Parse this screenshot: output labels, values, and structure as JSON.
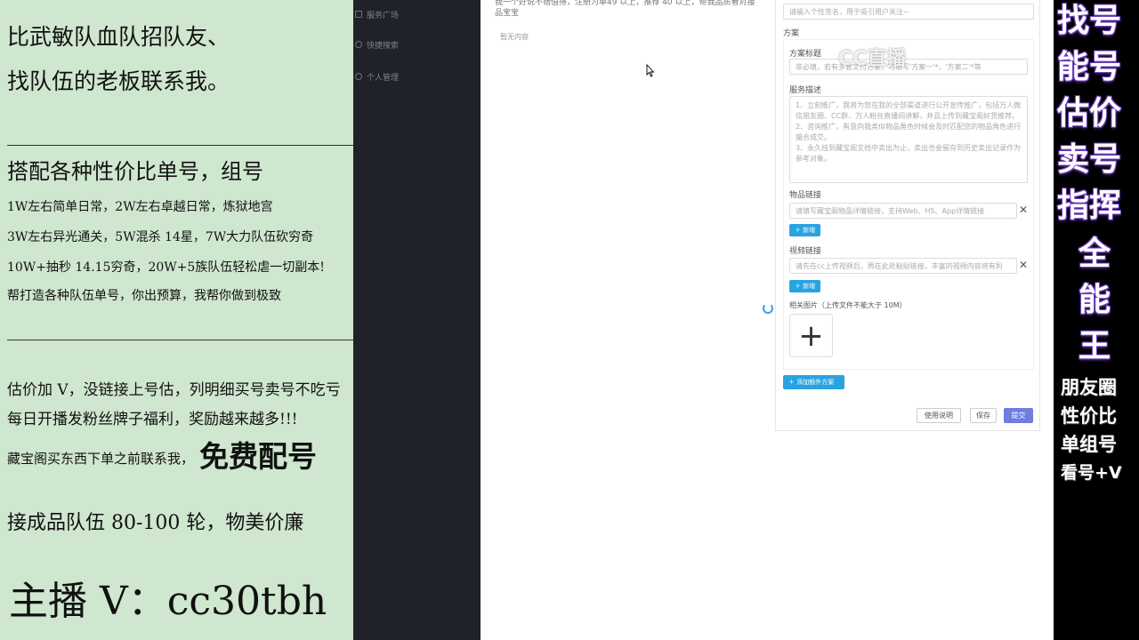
{
  "left_panel": {
    "line1": "比武敏队血队招队友、",
    "line2": "找队伍的老板联系我。",
    "heading": "搭配各种性价比单号，组号",
    "bullet1": "1W左右简单日常，2W左右卓越日常，炼狱地宫",
    "bullet2": "3W左右异光通关，5W混杀 14星，7W大力队伍砍穷奇",
    "bullet3": "10W+抽秒 14.15穷奇，20W+5族队伍轻松虐一切副本!",
    "bullet4": "帮打造各种队伍单号，你出预算，我帮你做到极致",
    "para1": "估价加 V，没链接上号估，列明细买号卖号不吃亏",
    "para2": "每日开播发粉丝牌子福利，奖励越来越多!!!",
    "para3": "藏宝阁买东西下单之前联系我，",
    "free_match": "免费配号",
    "para4": "接成品队伍 80-100 轮，物美价廉",
    "anchor": "主播 V：cc30tbh"
  },
  "sidebar": {
    "items": [
      {
        "label": "服务广场"
      },
      {
        "label": "快捷搜索"
      },
      {
        "label": "个人管理"
      }
    ]
  },
  "main": {
    "top_text": "我一个好说不错值得，注册为单49 以上，推荐 40 以上，帮我品质看对接品宝宝",
    "empty_text": "暂无内容"
  },
  "form": {
    "signature_placeholder": "请输入个性签名，用于吸引用户关注~",
    "plan_section": "方案",
    "plan_title_label": "方案标题",
    "plan_title_placeholder": "非必填，若有多套文付方案，可填写'方案一'*，'方案二'*等",
    "service_desc_label": "服务描述",
    "service_desc_text": "1、立刻推广，我将为您在我的全部渠道进行公开宣传推广，包括万人微信朋友圈、CC群、万人粉丝直播间讲解，并且上传到藏宝阁好货推荐。\n2、咨询推广，有意向我类似物品角色时候会及时匹配您的物品角色进行撮合成交。\n3、永久挂到藏宝阁文档中卖出为止，卖出也会留存到历史卖出记录作为参考对象。",
    "item_link_label": "物品链接",
    "item_link_placeholder": "请填写藏宝阁物品详情链接，支持Web、H5、App详情链接",
    "add_label": "新增",
    "video_link_label": "视频链接",
    "video_link_placeholder": "请先在cc上传视频后，再在此处粘贴链接，丰富的视频内容将有利",
    "image_label": "相关图片（上传文件不能大于 10M）",
    "upload_plus": "+",
    "add_plan_label": "添加额外方案",
    "help_label": "使用说明",
    "save_label": "保存",
    "submit_label": "提交",
    "close_glyph": "✕"
  },
  "watermark": "CC直播",
  "right_panel": {
    "big_chars": [
      "找号",
      "能号",
      "估价",
      "卖号",
      "指挥",
      "全",
      "能",
      "王"
    ],
    "small_lines": [
      "朋友圈",
      "性价比",
      "单组号",
      "看号+V"
    ]
  },
  "colors": {
    "left_bg": "#cfe6cf",
    "sidebar_bg": "#1f2229",
    "accent_blue": "#29a3e0",
    "submit_purple": "#6f7de0",
    "glow_purple": "#6f3fbf"
  }
}
